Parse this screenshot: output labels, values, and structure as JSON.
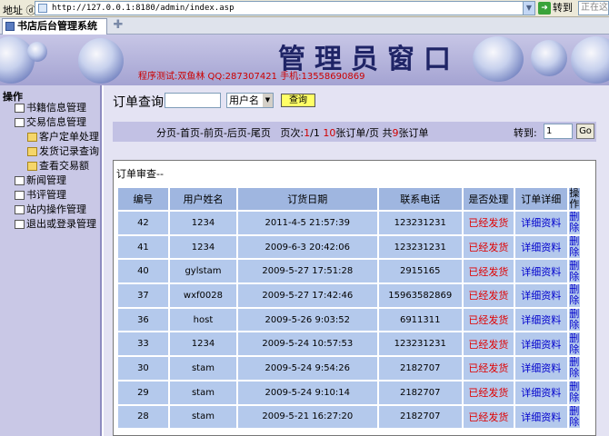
{
  "browser": {
    "address_label": "地址 ⓓ",
    "url": "http://127.0.0.1:8180/admin/index.asp",
    "go_label": "转到",
    "search_placeholder": "正在这里",
    "tab_title": "书店后台管理系统"
  },
  "banner": {
    "title": "管理员窗口",
    "subtitle": "程序测试:双鱼林 QQ:287307421 手机:13558690869"
  },
  "sidebar": {
    "header": "操作",
    "items": [
      {
        "label": "书籍信息管理"
      },
      {
        "label": "交易信息管理"
      },
      {
        "label": "客户定单处理"
      },
      {
        "label": "发货记录查询"
      },
      {
        "label": "查看交易额"
      },
      {
        "label": "新闻管理"
      },
      {
        "label": "书评管理"
      },
      {
        "label": "站内操作管理"
      },
      {
        "label": "退出或登录管理"
      }
    ]
  },
  "search": {
    "label": "订单查询",
    "select_value": "用户名",
    "button": "查询"
  },
  "pager": {
    "nav": "分页-首页-前页-后页-尾页",
    "page_prefix": "页次:",
    "page_current": "1",
    "page_sep": "/",
    "page_total": "1",
    "per_page": "10",
    "per_page_suffix": "张订单/页",
    "total_prefix": "共",
    "total": "9",
    "total_suffix": "张订单",
    "goto_label": "转到:",
    "goto_value": "1",
    "goto_button": "Go"
  },
  "orders": {
    "title": "订单审查--",
    "headers": [
      "编号",
      "用户姓名",
      "订货日期",
      "联系电话",
      "是否处理",
      "订单详细",
      "操作"
    ],
    "rows": [
      {
        "id": "42",
        "user": "1234",
        "date": "2011-4-5 21:57:39",
        "phone": "123231231",
        "status": "已经发货",
        "detail": "详细资料",
        "action": "删除"
      },
      {
        "id": "41",
        "user": "1234",
        "date": "2009-6-3 20:42:06",
        "phone": "123231231",
        "status": "已经发货",
        "detail": "详细资料",
        "action": "删除"
      },
      {
        "id": "40",
        "user": "gylstam",
        "date": "2009-5-27 17:51:28",
        "phone": "2915165",
        "status": "已经发货",
        "detail": "详细资料",
        "action": "删除"
      },
      {
        "id": "37",
        "user": "wxf0028",
        "date": "2009-5-27 17:42:46",
        "phone": "15963582869",
        "status": "已经发货",
        "detail": "详细资料",
        "action": "删除"
      },
      {
        "id": "36",
        "user": "host",
        "date": "2009-5-26 9:03:52",
        "phone": "6911311",
        "status": "已经发货",
        "detail": "详细资料",
        "action": "删除"
      },
      {
        "id": "33",
        "user": "1234",
        "date": "2009-5-24 10:57:53",
        "phone": "123231231",
        "status": "已经发货",
        "detail": "详细资料",
        "action": "删除"
      },
      {
        "id": "30",
        "user": "stam",
        "date": "2009-5-24 9:54:26",
        "phone": "2182707",
        "status": "已经发货",
        "detail": "详细资料",
        "action": "删除"
      },
      {
        "id": "29",
        "user": "stam",
        "date": "2009-5-24 9:10:14",
        "phone": "2182707",
        "status": "已经发货",
        "detail": "详细资料",
        "action": "删除"
      },
      {
        "id": "28",
        "user": "stam",
        "date": "2009-5-21 16:27:20",
        "phone": "2182707",
        "status": "已经发货",
        "detail": "详细资料",
        "action": "删除"
      }
    ]
  }
}
